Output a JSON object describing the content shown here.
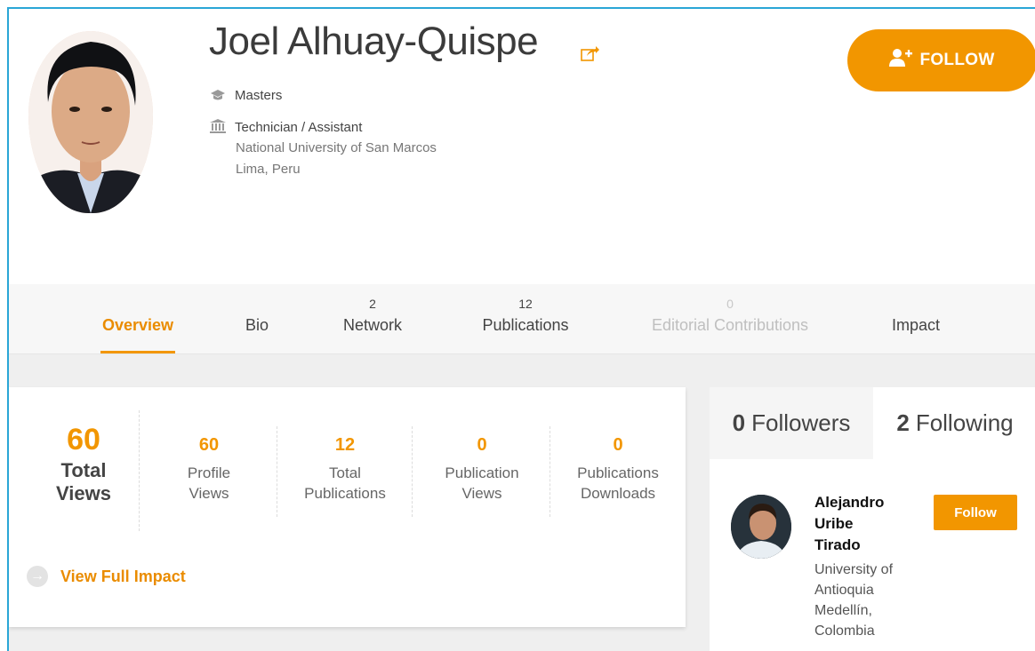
{
  "profile": {
    "name": "Joel Alhuay-Quispe",
    "degree": "Masters",
    "position": "Technician / Assistant",
    "institution": "National University of San Marcos",
    "location": "Lima, Peru",
    "follow_label": "FOLLOW"
  },
  "tabs": [
    {
      "count": "",
      "label": "Overview",
      "state": "active"
    },
    {
      "count": "",
      "label": "Bio",
      "state": "normal"
    },
    {
      "count": "2",
      "label": "Network",
      "state": "normal"
    },
    {
      "count": "12",
      "label": "Publications",
      "state": "normal"
    },
    {
      "count": "0",
      "label": "Editorial Contributions",
      "state": "disabled"
    },
    {
      "count": "",
      "label": "Impact",
      "state": "normal"
    }
  ],
  "stats": {
    "total_views": {
      "value": "60",
      "label_line1": "Total",
      "label_line2": "Views"
    },
    "items": [
      {
        "value": "60",
        "line1": "Profile",
        "line2": "Views"
      },
      {
        "value": "12",
        "line1": "Total",
        "line2": "Publications"
      },
      {
        "value": "0",
        "line1": "Publication",
        "line2": "Views"
      },
      {
        "value": "0",
        "line1": "Publications",
        "line2": "Downloads"
      }
    ],
    "view_full_impact": "View Full Impact"
  },
  "network": {
    "followers_count": "0",
    "followers_label": "Followers",
    "following_count": "2",
    "following_label": "Following",
    "person": {
      "name_line1": "Alejandro",
      "name_line2": "Uribe",
      "name_line3": "Tirado",
      "aff_line1": "University of",
      "aff_line2": "Antioquia",
      "aff_line3": "Medellín,",
      "aff_line4": "Colombia",
      "follow_label": "Follow"
    }
  },
  "colors": {
    "accent": "#f29600",
    "frame": "#2aa6d6"
  },
  "icons": [
    "graduation-cap-icon",
    "institution-icon",
    "share-icon",
    "add-user-icon",
    "arrow-circle-icon"
  ]
}
